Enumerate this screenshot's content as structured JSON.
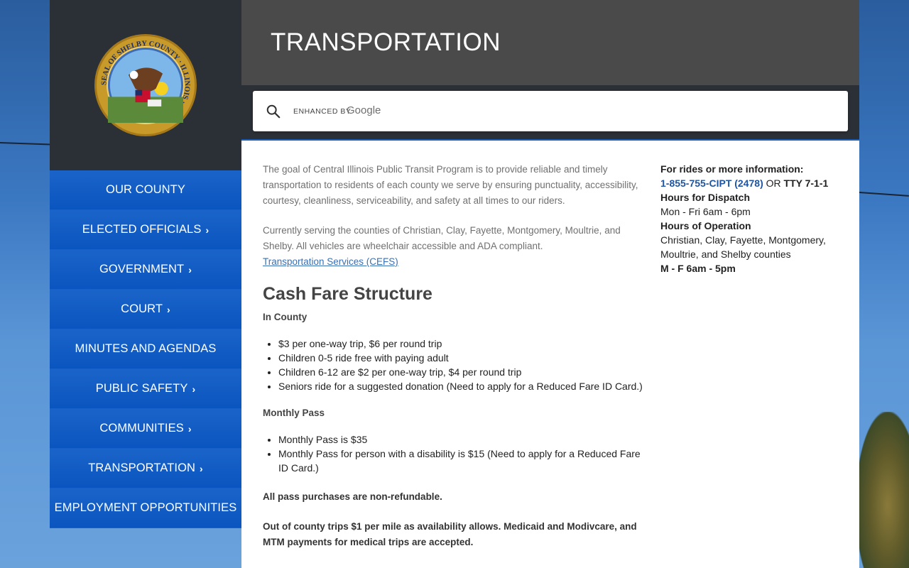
{
  "header": {
    "title": "TRANSPORTATION"
  },
  "search": {
    "enhanced_by": "ENHANCED BY",
    "brand": "Google"
  },
  "logo": {
    "alt": "Seal of Shelby County Illinois",
    "ring_text": "SEAL OF SHELBY COUNTY · ILLINOIS ·"
  },
  "nav": {
    "items": [
      {
        "label": "OUR COUNTY",
        "chevron": false
      },
      {
        "label": "ELECTED OFFICIALS",
        "chevron": true
      },
      {
        "label": "GOVERNMENT",
        "chevron": true
      },
      {
        "label": "COURT",
        "chevron": true
      },
      {
        "label": "MINUTES AND AGENDAS",
        "chevron": false
      },
      {
        "label": "PUBLIC SAFETY",
        "chevron": true
      },
      {
        "label": "COMMUNITIES",
        "chevron": true
      },
      {
        "label": "TRANSPORTATION",
        "chevron": true
      },
      {
        "label": "EMPLOYMENT OPPORTUNITIES",
        "chevron": false
      }
    ],
    "chevron_glyph": "›"
  },
  "main": {
    "intro1": "The goal of Central Illinois Public Transit Program is to provide reliable and timely transportation to residents of each county we serve by ensuring punctuality, accessibility, courtesy, cleanliness, serviceability, and safety at all times to our riders.",
    "intro2": "Currently serving the counties of Christian, Clay, Fayette, Montgomery, Moultrie, and Shelby. All vehicles are wheelchair accessible and ADA compliant.",
    "link": "Transportation Services (CEFS)",
    "cash_heading": "Cash Fare Structure",
    "in_county": "In County",
    "in_county_items": [
      "$3 per one-way trip, $6 per round trip",
      "Children 0-5 ride free with paying adult",
      "Children 6-12 are $2 per one-way trip, $4 per round trip",
      "Seniors ride for a suggested donation (Need to apply for a Reduced Fare ID Card.)"
    ],
    "monthly_pass": "Monthly Pass",
    "monthly_items": [
      "Monthly Pass is $35",
      "Monthly Pass for person with a disability is $15 (Need to apply for a Reduced Fare ID Card.)"
    ],
    "non_refundable": "All pass purchases are non-refundable.",
    "out_of_county": "Out of county trips $1 per mile as availability allows. Medicaid and Modivcare, and MTM payments for medical trips are accepted."
  },
  "aside": {
    "rides_info": "For rides or more information:",
    "phone": "1-855-755-CIPT (2478)",
    "or": "OR",
    "tty": "TTY 7-1-1",
    "dispatch_label": "Hours for Dispatch",
    "dispatch_hours": "Mon - Fri 6am - 6pm",
    "operation_label": "Hours of Operation",
    "operation_counties": "Christian, Clay, Fayette, Montgomery, Moultrie, and Shelby counties",
    "operation_hours": "M - F 6am - 5pm"
  },
  "colors": {
    "nav_blue": "#0a55bf",
    "header_gray": "#4a4a4a",
    "dark_panel": "#2b2f36",
    "link_blue": "#1e55a3"
  }
}
